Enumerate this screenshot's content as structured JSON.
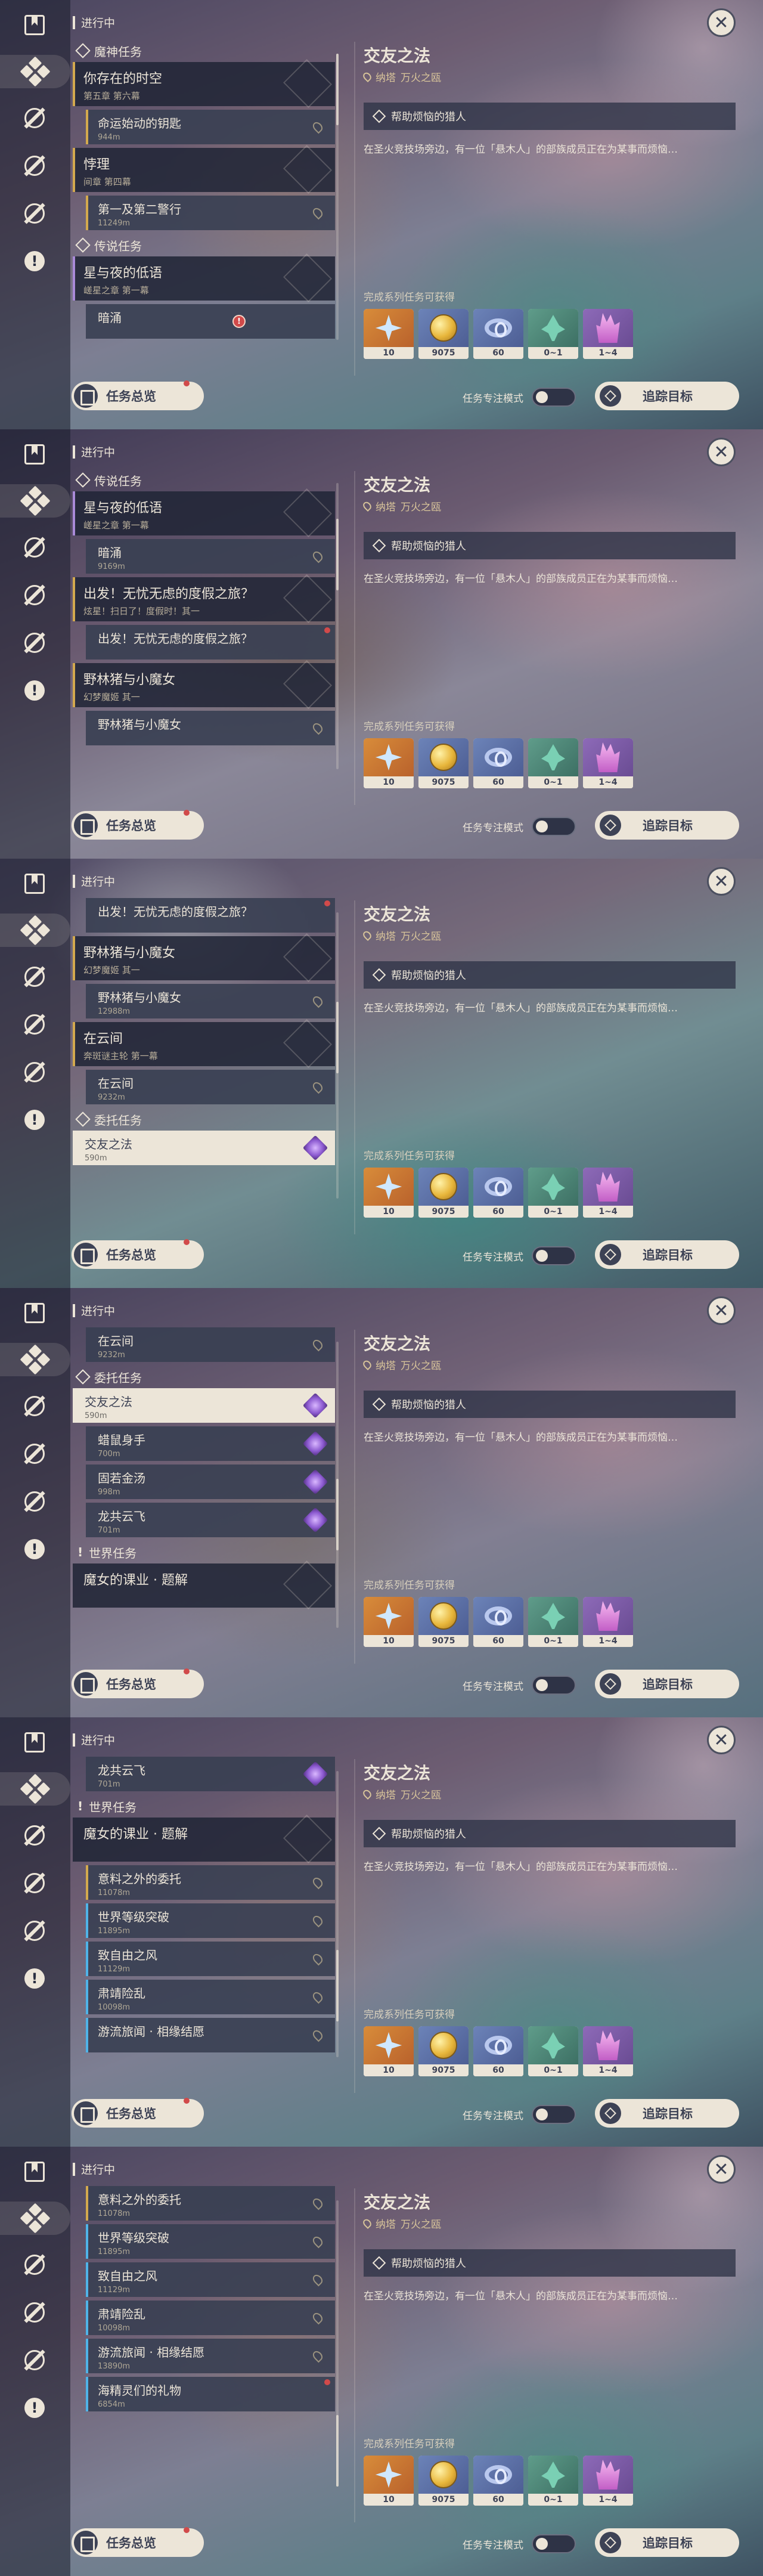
{
  "common": {
    "header": "进行中",
    "overview_label": "任务总览",
    "focus_label": "任务专注模式",
    "track_label": "追踪目标",
    "close_symbol": "✕",
    "quest_title": "交友之法",
    "quest_region": "纳塔",
    "quest_area": "万火之瓯",
    "step": "帮助烦恼的猎人",
    "description": "在圣火竞技场旁边，有一位「悬木人」的部族成员正在为某事而烦恼…",
    "reward_label": "完成系列任务可获得",
    "rewards": [
      {
        "icon": "intertwined-fate-icon",
        "count": "10"
      },
      {
        "icon": "mora-icon",
        "count": "9075"
      },
      {
        "icon": "adventure-exp-icon",
        "count": "60"
      },
      {
        "icon": "sprout-icon",
        "count": "0~1"
      },
      {
        "icon": "crystal-icon",
        "count": "1~4"
      }
    ]
  },
  "frames": [
    {
      "items": [
        {
          "kind": "cat",
          "icon": "diamond",
          "label": "魔神任务"
        },
        {
          "kind": "chapter",
          "accent": "gold",
          "title": "你存在的时空",
          "subtitle": "第五章 第六幕"
        },
        {
          "kind": "sub",
          "accent": "gold",
          "title": "命运始动的钥匙",
          "dist": "944m"
        },
        {
          "kind": "chapter",
          "accent": "gold",
          "title": "悖理",
          "subtitle": "间章 第四幕"
        },
        {
          "kind": "sub",
          "accent": "gold",
          "title": "第一及第二警行",
          "dist": "11249m"
        },
        {
          "kind": "cat",
          "icon": "diamond",
          "label": "传说任务"
        },
        {
          "kind": "chapter",
          "accent": "leg",
          "title": "星与夜的低语",
          "subtitle": "嵯星之章 第一幕"
        },
        {
          "kind": "sub",
          "accent": "plain",
          "title": "暗涌",
          "dist": "",
          "badge": "!"
        }
      ]
    },
    {
      "items": [
        {
          "kind": "cat",
          "icon": "diamond",
          "label": "传说任务"
        },
        {
          "kind": "chapter",
          "accent": "leg",
          "title": "星与夜的低语",
          "subtitle": "嵯星之章 第一幕"
        },
        {
          "kind": "sub",
          "accent": "plain",
          "title": "暗涌",
          "dist": "9169m"
        },
        {
          "kind": "chapter",
          "accent": "gold",
          "title": "出发！无忧无虑的度假之旅？",
          "subtitle": "炫星！扫日了！度假时！其一"
        },
        {
          "kind": "sub",
          "accent": "plain",
          "title": "出发！无忧无虑的度假之旅？",
          "dist": "",
          "badge": "dot"
        },
        {
          "kind": "chapter",
          "accent": "gold",
          "title": "野林猪与小魔女",
          "subtitle": "幻梦魔姬 其一"
        },
        {
          "kind": "sub",
          "accent": "plain",
          "title": "野林猪与小魔女",
          "dist": ""
        }
      ]
    },
    {
      "items": [
        {
          "kind": "sub",
          "accent": "plain",
          "title": "出发！无忧无虑的度假之旅？",
          "dist": "",
          "badge": "dot"
        },
        {
          "kind": "chapter",
          "accent": "gold",
          "title": "野林猪与小魔女",
          "subtitle": "幻梦魔姬 其一"
        },
        {
          "kind": "sub",
          "accent": "plain",
          "title": "野林猪与小魔女",
          "dist": "12988m"
        },
        {
          "kind": "chapter",
          "accent": "gold",
          "title": "在云间",
          "subtitle": "奔斑谜主轮 第一幕"
        },
        {
          "kind": "sub",
          "accent": "plain",
          "title": "在云间",
          "dist": "9232m"
        },
        {
          "kind": "cat",
          "icon": "diamond",
          "label": "委托任务"
        },
        {
          "kind": "sub",
          "accent": "sel",
          "title": "交友之法",
          "dist": "590m",
          "badge": "purple"
        }
      ]
    },
    {
      "items": [
        {
          "kind": "sub",
          "accent": "plain",
          "title": "在云间",
          "dist": "9232m"
        },
        {
          "kind": "cat",
          "icon": "diamond",
          "label": "委托任务"
        },
        {
          "kind": "sub",
          "accent": "sel",
          "title": "交友之法",
          "dist": "590m",
          "badge": "purple"
        },
        {
          "kind": "sub",
          "accent": "plain",
          "title": "蜡鼠身手",
          "dist": "700m",
          "badge": "purple"
        },
        {
          "kind": "sub",
          "accent": "plain",
          "title": "固若金汤",
          "dist": "998m",
          "badge": "purple"
        },
        {
          "kind": "sub",
          "accent": "plain",
          "title": "龙共云飞",
          "dist": "701m",
          "badge": "purple"
        },
        {
          "kind": "cat",
          "icon": "excl",
          "label": "世界任务"
        },
        {
          "kind": "chapter",
          "accent": "plain",
          "title": "魔女的课业 · 题解",
          "subtitle": ""
        }
      ]
    },
    {
      "items": [
        {
          "kind": "sub",
          "accent": "plain",
          "title": "龙共云飞",
          "dist": "701m",
          "badge": "purple"
        },
        {
          "kind": "cat",
          "icon": "excl",
          "label": "世界任务"
        },
        {
          "kind": "chapter",
          "accent": "plain",
          "title": "魔女的课业 · 题解",
          "subtitle": ""
        },
        {
          "kind": "sub",
          "accent": "gold",
          "title": "意料之外的委托",
          "dist": "11078m"
        },
        {
          "kind": "sub",
          "accent": "blue",
          "title": "世界等级突破",
          "dist": "11895m"
        },
        {
          "kind": "sub",
          "accent": "blue",
          "title": "致自由之风",
          "dist": "11129m"
        },
        {
          "kind": "sub",
          "accent": "blue",
          "title": "肃靖险乱",
          "dist": "10098m"
        },
        {
          "kind": "sub",
          "accent": "blue",
          "title": "游流旅闻 · 相缘结愿",
          "dist": ""
        }
      ]
    },
    {
      "items": [
        {
          "kind": "sub",
          "accent": "gold",
          "title": "意料之外的委托",
          "dist": "11078m"
        },
        {
          "kind": "sub",
          "accent": "blue",
          "title": "世界等级突破",
          "dist": "11895m"
        },
        {
          "kind": "sub",
          "accent": "blue",
          "title": "致自由之风",
          "dist": "11129m"
        },
        {
          "kind": "sub",
          "accent": "blue",
          "title": "肃靖险乱",
          "dist": "10098m"
        },
        {
          "kind": "sub",
          "accent": "blue",
          "title": "游流旅闻 · 相缘结愿",
          "dist": "13890m"
        },
        {
          "kind": "sub",
          "accent": "blue",
          "title": "海精灵们的礼物",
          "dist": "6854m",
          "badge": "dot"
        }
      ]
    }
  ]
}
